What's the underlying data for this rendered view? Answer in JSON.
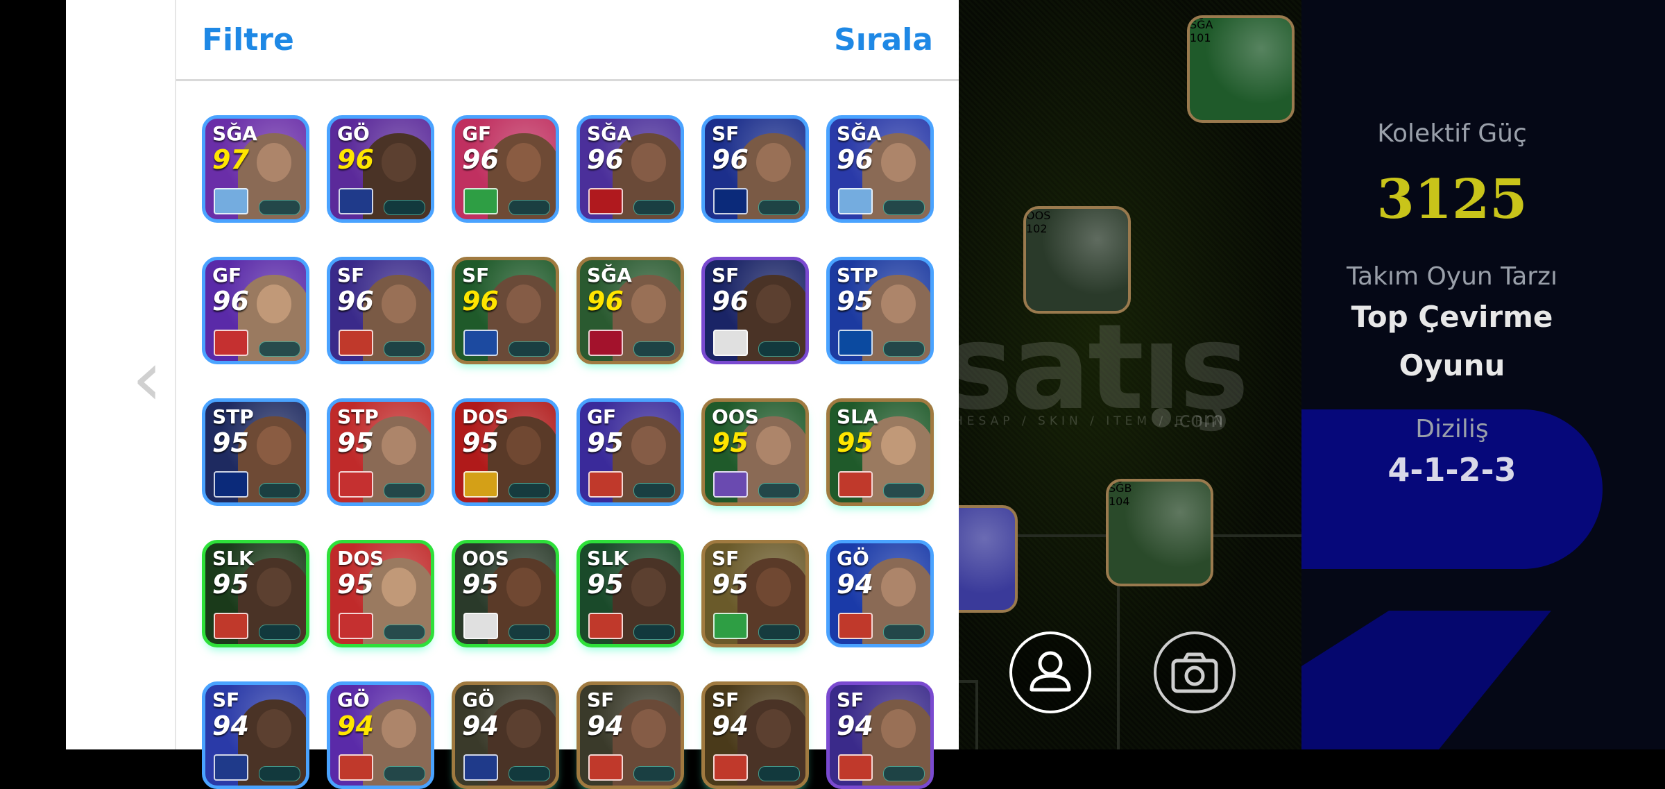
{
  "panel": {
    "filter_label": "Filtre",
    "sort_label": "Sırala"
  },
  "navigation": {
    "back_icon_glyph": "‹"
  },
  "cards": [
    {
      "position": "SĞA",
      "rating": "97",
      "gold": true,
      "bg": "#6a2ea8",
      "border": "#4aa3ff",
      "emblem": "#74acdf",
      "portrait": "#8a6a55"
    },
    {
      "position": "GÖ",
      "rating": "96",
      "gold": true,
      "bg": "#5b2a9a",
      "border": "#4aa3ff",
      "emblem": "#1f3a8a",
      "portrait": "#4a3326"
    },
    {
      "position": "GF",
      "rating": "96",
      "gold": false,
      "bg": "#c03060",
      "border": "#4aa3ff",
      "emblem": "#2e9e44",
      "portrait": "#6e4a35"
    },
    {
      "position": "SĞA",
      "rating": "96",
      "gold": false,
      "bg": "#4b2f9a",
      "border": "#4aa3ff",
      "emblem": "#b0191e",
      "portrait": "#6a4a38"
    },
    {
      "position": "SF",
      "rating": "96",
      "gold": false,
      "bg": "#1c2f8c",
      "border": "#4aa3ff",
      "emblem": "#0b2a7a",
      "portrait": "#7a5a45"
    },
    {
      "position": "SĞA",
      "rating": "96",
      "gold": false,
      "bg": "#2a3aa8",
      "border": "#4aa3ff",
      "emblem": "#74acdf",
      "portrait": "#8a6a55"
    },
    {
      "position": "GF",
      "rating": "96",
      "gold": false,
      "bg": "#5a2aa8",
      "border": "#4aa3ff",
      "emblem": "#c53030",
      "portrait": "#9a7a60"
    },
    {
      "position": "SF",
      "rating": "96",
      "gold": false,
      "bg": "#3a2a8a",
      "border": "#4aa3ff",
      "emblem": "#c0392b",
      "portrait": "#7a5a45"
    },
    {
      "position": "SF",
      "rating": "96",
      "gold": true,
      "bg": "#1f5a2a",
      "border": "#a07a40",
      "emblem": "#1c4aa0",
      "portrait": "#6a4a38"
    },
    {
      "position": "SĞA",
      "rating": "96",
      "gold": true,
      "bg": "#2a5a30",
      "border": "#a07a40",
      "emblem": "#a3122c",
      "portrait": "#7a5a45"
    },
    {
      "position": "SF",
      "rating": "96",
      "gold": false,
      "bg": "#1a2466",
      "border": "#7a4ad0",
      "emblem": "#e0e0e0",
      "portrait": "#4a3326"
    },
    {
      "position": "STP",
      "rating": "95",
      "gold": false,
      "bg": "#1c3aa0",
      "border": "#4aa3ff",
      "emblem": "#0b4aa0",
      "portrait": "#8a6a55"
    },
    {
      "position": "STP",
      "rating": "95",
      "gold": false,
      "bg": "#1e2a60",
      "border": "#4aa3ff",
      "emblem": "#0b2a7a",
      "portrait": "#6e4a35"
    },
    {
      "position": "STP",
      "rating": "95",
      "gold": false,
      "bg": "#c02a2a",
      "border": "#4aa3ff",
      "emblem": "#c53030",
      "portrait": "#8a6a55"
    },
    {
      "position": "DOS",
      "rating": "95",
      "gold": false,
      "bg": "#b01a1a",
      "border": "#4aa3ff",
      "emblem": "#d4a017",
      "portrait": "#5a3a28"
    },
    {
      "position": "GF",
      "rating": "95",
      "gold": false,
      "bg": "#3a2a9a",
      "border": "#4aa3ff",
      "emblem": "#c0392b",
      "portrait": "#6a4a38"
    },
    {
      "position": "OOS",
      "rating": "95",
      "gold": true,
      "bg": "#1f5a2a",
      "border": "#a07a40",
      "emblem": "#6a4ab0",
      "portrait": "#8a6a55"
    },
    {
      "position": "SLA",
      "rating": "95",
      "gold": true,
      "bg": "#1f5a2a",
      "border": "#a07a40",
      "emblem": "#c0392b",
      "portrait": "#9a7a60"
    },
    {
      "position": "SLK",
      "rating": "95",
      "gold": false,
      "bg": "#1a3a1a",
      "border": "#2ee03a",
      "emblem": "#c0392b",
      "portrait": "#4a3326"
    },
    {
      "position": "DOS",
      "rating": "95",
      "gold": false,
      "bg": "#c02a2a",
      "border": "#2ee03a",
      "emblem": "#c53030",
      "portrait": "#9a7a60"
    },
    {
      "position": "OOS",
      "rating": "95",
      "gold": false,
      "bg": "#2a3a2a",
      "border": "#2ee03a",
      "emblem": "#e0e0e0",
      "portrait": "#5a3a28"
    },
    {
      "position": "SLK",
      "rating": "95",
      "gold": false,
      "bg": "#1a4a2a",
      "border": "#2ee03a",
      "emblem": "#c0392b",
      "portrait": "#4a3326"
    },
    {
      "position": "SF",
      "rating": "95",
      "gold": false,
      "bg": "#6a5a2a",
      "border": "#a07a40",
      "emblem": "#2e9e44",
      "portrait": "#5a3a28"
    },
    {
      "position": "GÖ",
      "rating": "94",
      "gold": false,
      "bg": "#1a3aa8",
      "border": "#4aa3ff",
      "emblem": "#c0392b",
      "portrait": "#8a6a55"
    },
    {
      "position": "SF",
      "rating": "94",
      "gold": false,
      "bg": "#2a3aa8",
      "border": "#4aa3ff",
      "emblem": "#1f3a8a",
      "portrait": "#4a3326"
    },
    {
      "position": "GÖ",
      "rating": "94",
      "gold": true,
      "bg": "#5a2aa8",
      "border": "#4aa3ff",
      "emblem": "#c0392b",
      "portrait": "#8a6a55"
    },
    {
      "position": "GÖ",
      "rating": "94",
      "gold": false,
      "bg": "#3a3a2a",
      "border": "#a07a40",
      "emblem": "#1f3a8a",
      "portrait": "#4a3326"
    },
    {
      "position": "SF",
      "rating": "94",
      "gold": false,
      "bg": "#3a3a2a",
      "border": "#a07a40",
      "emblem": "#c0392b",
      "portrait": "#6a4a38"
    },
    {
      "position": "SF",
      "rating": "94",
      "gold": false,
      "bg": "#4a3a1a",
      "border": "#a07a40",
      "emblem": "#c0392b",
      "portrait": "#4a3326"
    },
    {
      "position": "SF",
      "rating": "94",
      "gold": false,
      "bg": "#3a2a8a",
      "border": "#7a4ad0",
      "emblem": "#c0392b",
      "portrait": "#7a5a45"
    }
  ],
  "pitch_cards": [
    {
      "position": "SĞA",
      "rating": "101",
      "bg": "#1f5a2a",
      "emblem": "#1c4aa0",
      "portrait": "#9a7a60"
    },
    {
      "position": "OOS",
      "rating": "102",
      "bg": "#2a3a2a",
      "emblem": "#e0e0e0",
      "portrait": "#9a7a60"
    },
    {
      "position": "SĞB",
      "rating": "104",
      "bg": "#2a4a2a",
      "emblem": "#dd0000",
      "portrait": "#8a6a55"
    }
  ],
  "watermark": {
    "main": "satış",
    "sub": "HESAP / SKIN / ITEM / E-PIN",
    "domain": ".com"
  },
  "team": {
    "collective_label": "Kolektif Güç",
    "collective_value": "3125",
    "style_label": "Takım Oyun Tarzı",
    "style_value_line1": "Top Çevirme",
    "style_value_line2": "Oyunu",
    "formation_label": "Diziliş",
    "formation_value": "4-1-2-3"
  },
  "buttons": {
    "profile_icon": "user-icon",
    "camera_icon": "camera-icon"
  }
}
